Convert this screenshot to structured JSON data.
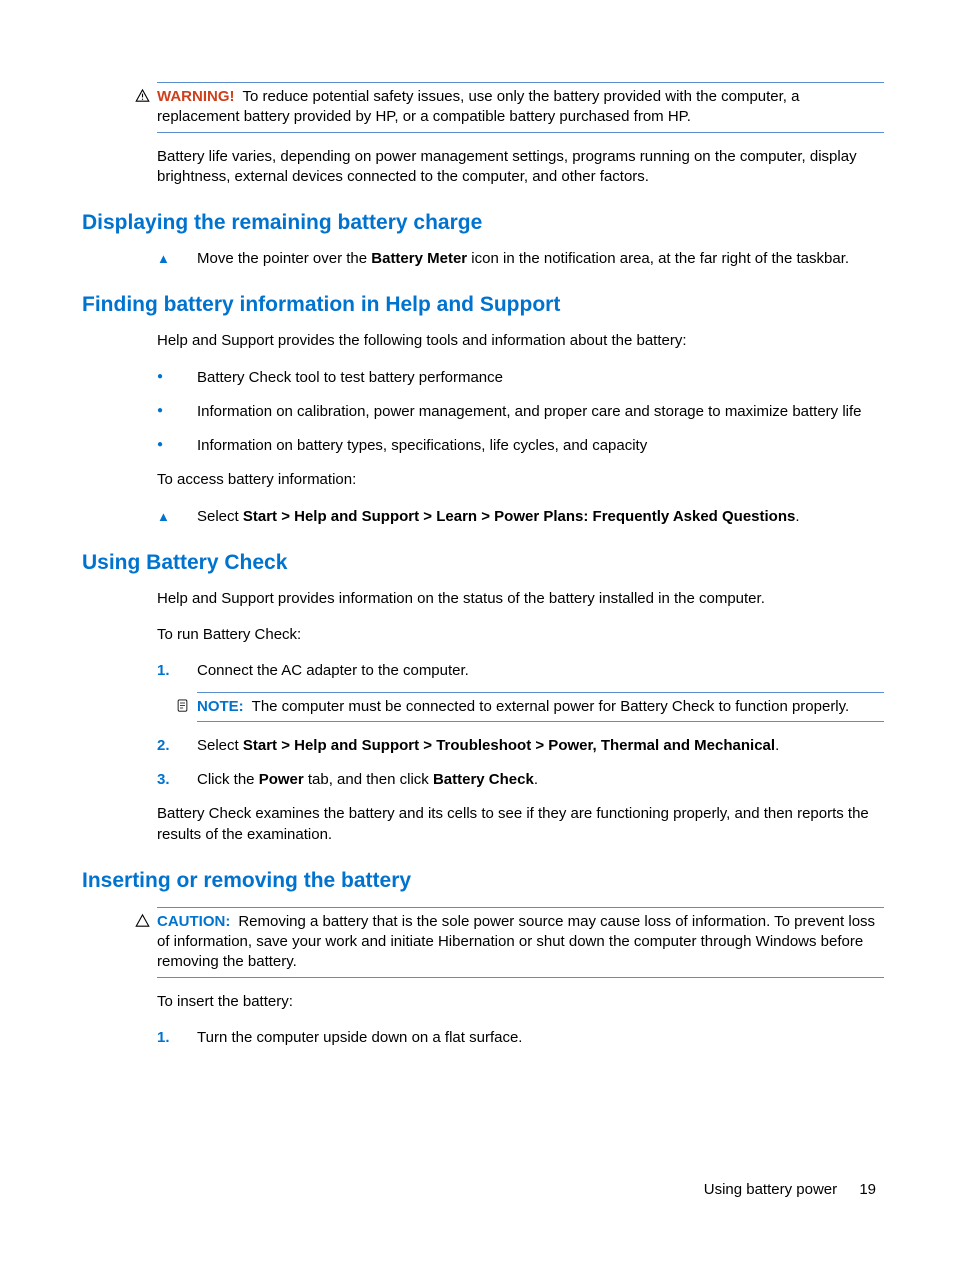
{
  "warning": {
    "label": "WARNING!",
    "text": "To reduce potential safety issues, use only the battery provided with the computer, a replacement battery provided by HP, or a compatible battery purchased from HP."
  },
  "intro_para": "Battery life varies, depending on power management settings, programs running on the computer, display brightness, external devices connected to the computer, and other factors.",
  "s1": {
    "heading": "Displaying the remaining battery charge",
    "step_pre": "Move the pointer over the ",
    "step_bold": "Battery Meter",
    "step_post": " icon in the notification area, at the far right of the taskbar."
  },
  "s2": {
    "heading": "Finding battery information in Help and Support",
    "p1": "Help and Support provides the following tools and information about the battery:",
    "b1": "Battery Check tool to test battery performance",
    "b2": "Information on calibration, power management, and proper care and storage to maximize battery life",
    "b3": "Information on battery types, specifications, life cycles, and capacity",
    "p2": "To access battery information:",
    "action_pre": "Select ",
    "action_bold": "Start > Help and Support > Learn > Power Plans: Frequently Asked Questions",
    "action_post": "."
  },
  "s3": {
    "heading": "Using Battery Check",
    "p1": "Help and Support provides information on the status of the battery installed in the computer.",
    "p2": "To run Battery Check:",
    "li1_num": "1.",
    "li1_text": "Connect the AC adapter to the computer.",
    "note_label": "NOTE:",
    "note_text": "The computer must be connected to external power for Battery Check to function properly.",
    "li2_num": "2.",
    "li2_pre": "Select ",
    "li2_bold": "Start > Help and Support > Troubleshoot > Power, Thermal and Mechanical",
    "li2_post": ".",
    "li3_num": "3.",
    "li3_pre": "Click the ",
    "li3_bold1": "Power",
    "li3_mid": " tab, and then click ",
    "li3_bold2": "Battery Check",
    "li3_post": ".",
    "p3": "Battery Check examines the battery and its cells to see if they are functioning properly, and then reports the results of the examination."
  },
  "s4": {
    "heading": "Inserting or removing the battery",
    "caution_label": "CAUTION:",
    "caution_text": "Removing a battery that is the sole power source may cause loss of information. To prevent loss of information, save your work and initiate Hibernation or shut down the computer through Windows before removing the battery.",
    "p1": "To insert the battery:",
    "li1_num": "1.",
    "li1_text": "Turn the computer upside down on a flat surface."
  },
  "footer": {
    "section": "Using battery power",
    "page": "19"
  }
}
